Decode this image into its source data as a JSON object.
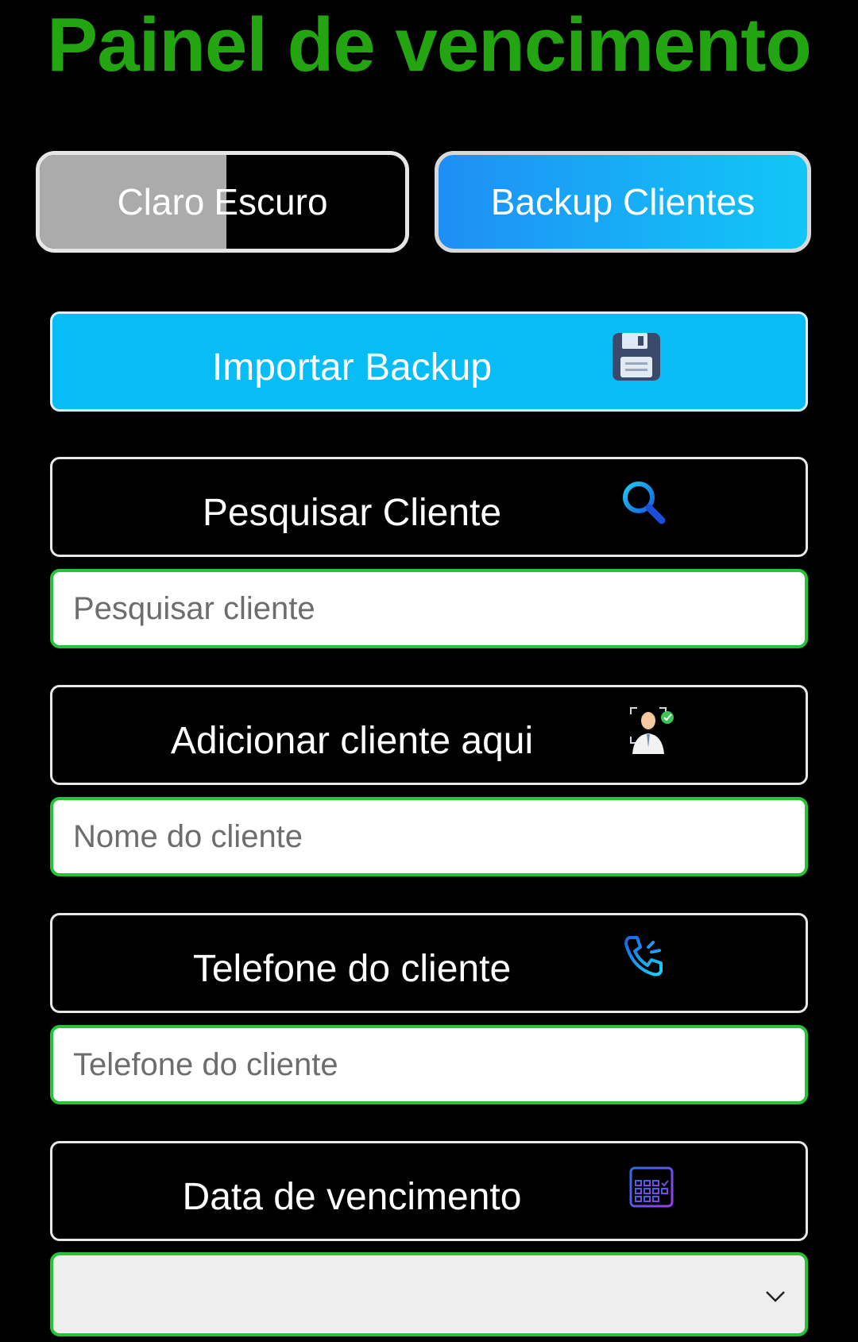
{
  "page_title": "Painel de vencimento",
  "theme_toggle": {
    "light_label": "Claro",
    "dark_label": "Escuro"
  },
  "backup_button": {
    "label": "Backup Clientes"
  },
  "import_backup": {
    "label": "Importar Backup",
    "icon": "floppy-disk-icon"
  },
  "search": {
    "section_label": "Pesquisar Cliente",
    "icon": "magnifier-icon",
    "placeholder": "Pesquisar cliente"
  },
  "add_client": {
    "section_label": "Adicionar cliente aqui",
    "icon": "user-check-icon",
    "placeholder": "Nome do cliente"
  },
  "phone": {
    "section_label": "Telefone do cliente",
    "icon": "phone-ringing-icon",
    "placeholder": "Telefone do cliente"
  },
  "due_date": {
    "section_label": "Data de vencimento",
    "icon": "calendar-icon",
    "selected_value": ""
  },
  "colors": {
    "title_green": "#22a511",
    "input_border_green": "#27c237",
    "accent_blue": "#08bcf6",
    "toggle_light_gray": "#ababab"
  }
}
